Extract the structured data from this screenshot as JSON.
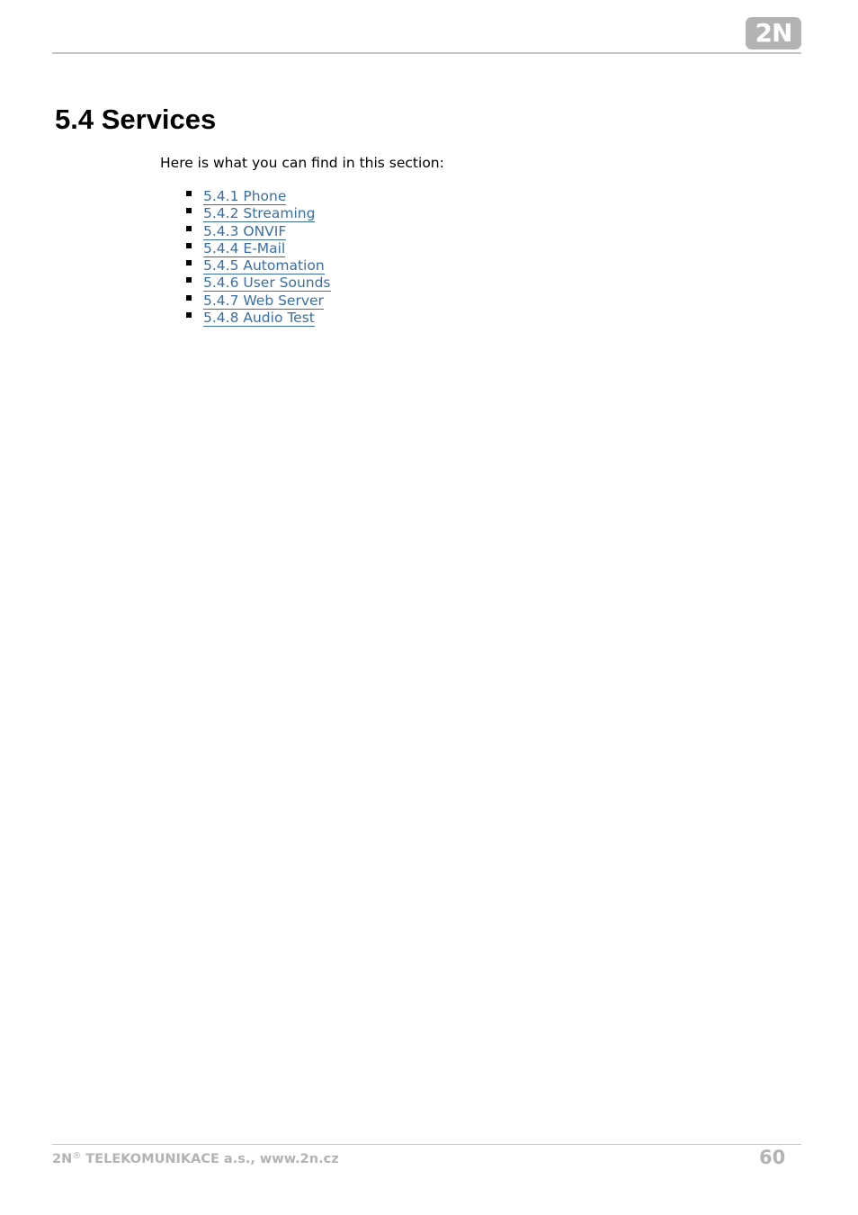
{
  "header": {
    "logo_text": "2N"
  },
  "section": {
    "title": "5.4 Services",
    "intro": "Here is what you can find in this section:",
    "links": [
      {
        "label": "5.4.1 Phone"
      },
      {
        "label": "5.4.2 Streaming"
      },
      {
        "label": "5.4.3 ONVIF"
      },
      {
        "label": "5.4.4 E-Mail"
      },
      {
        "label": "5.4.5 Automation"
      },
      {
        "label": "5.4.6 User Sounds"
      },
      {
        "label": "5.4.7 Web Server"
      },
      {
        "label": "5.4.8 Audio Test"
      }
    ]
  },
  "footer": {
    "brand": "2N",
    "registered": "®",
    "company": " TELEKOMUNIKACE a.s., www.2n.cz",
    "page_number": "60"
  },
  "colors": {
    "link": "#3a6ea5",
    "footer_gray": "#b3b3b3"
  }
}
